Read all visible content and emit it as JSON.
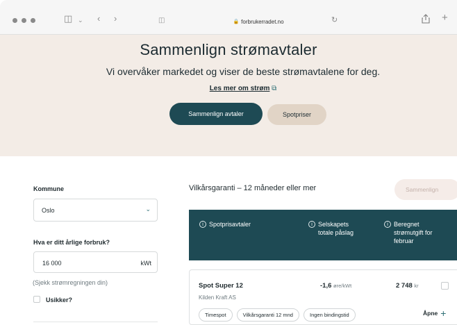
{
  "browser": {
    "url": "forbrukerradet.no",
    "icons": [
      "sidebar-icon",
      "back-icon",
      "forward-icon",
      "shield-icon",
      "lock-icon",
      "reload-icon",
      "share-icon",
      "new-tab-icon"
    ]
  },
  "hero": {
    "title": "Sammenlign strømavtaler",
    "subtitle": "Vi overvåker markedet og viser de beste strømavtalene for deg.",
    "more_link": "Les mer om strøm",
    "primary_button": "Sammenlign avtaler",
    "secondary_button": "Spotpriser"
  },
  "filters": {
    "municipality_label": "Kommune",
    "municipality_value": "Oslo",
    "usage_label": "Hva er ditt årlige forbruk?",
    "usage_value": "16 000",
    "usage_unit": "kWt",
    "hint": "(Sjekk strømregningen din)",
    "unsure_label": "Usikker?"
  },
  "results": {
    "filter_title": "Vilkårsgaranti – 12 måneder eller mer",
    "compare_button": "Sammenlign",
    "columns": [
      {
        "label": "Spotprisavtaler"
      },
      {
        "label": "Selskapets totale påslag"
      },
      {
        "label": "Beregnet strømutgift for februar"
      }
    ],
    "rows": [
      {
        "name": "Spot Super 12",
        "company": "Kilden Kraft AS",
        "fee": "-1,6",
        "fee_unit": "øre/kWt",
        "cost": "2 748",
        "cost_unit": "kr",
        "tags": [
          "Timespot",
          "Vilkårsgaranti 12 mnd",
          "Ingen bindingstid"
        ],
        "open_label": "Åpne"
      }
    ]
  },
  "colors": {
    "hero_bg": "#f3ece6",
    "primary": "#1e4a54",
    "secondary": "#e1d4c6",
    "accent": "#2c6e74"
  }
}
